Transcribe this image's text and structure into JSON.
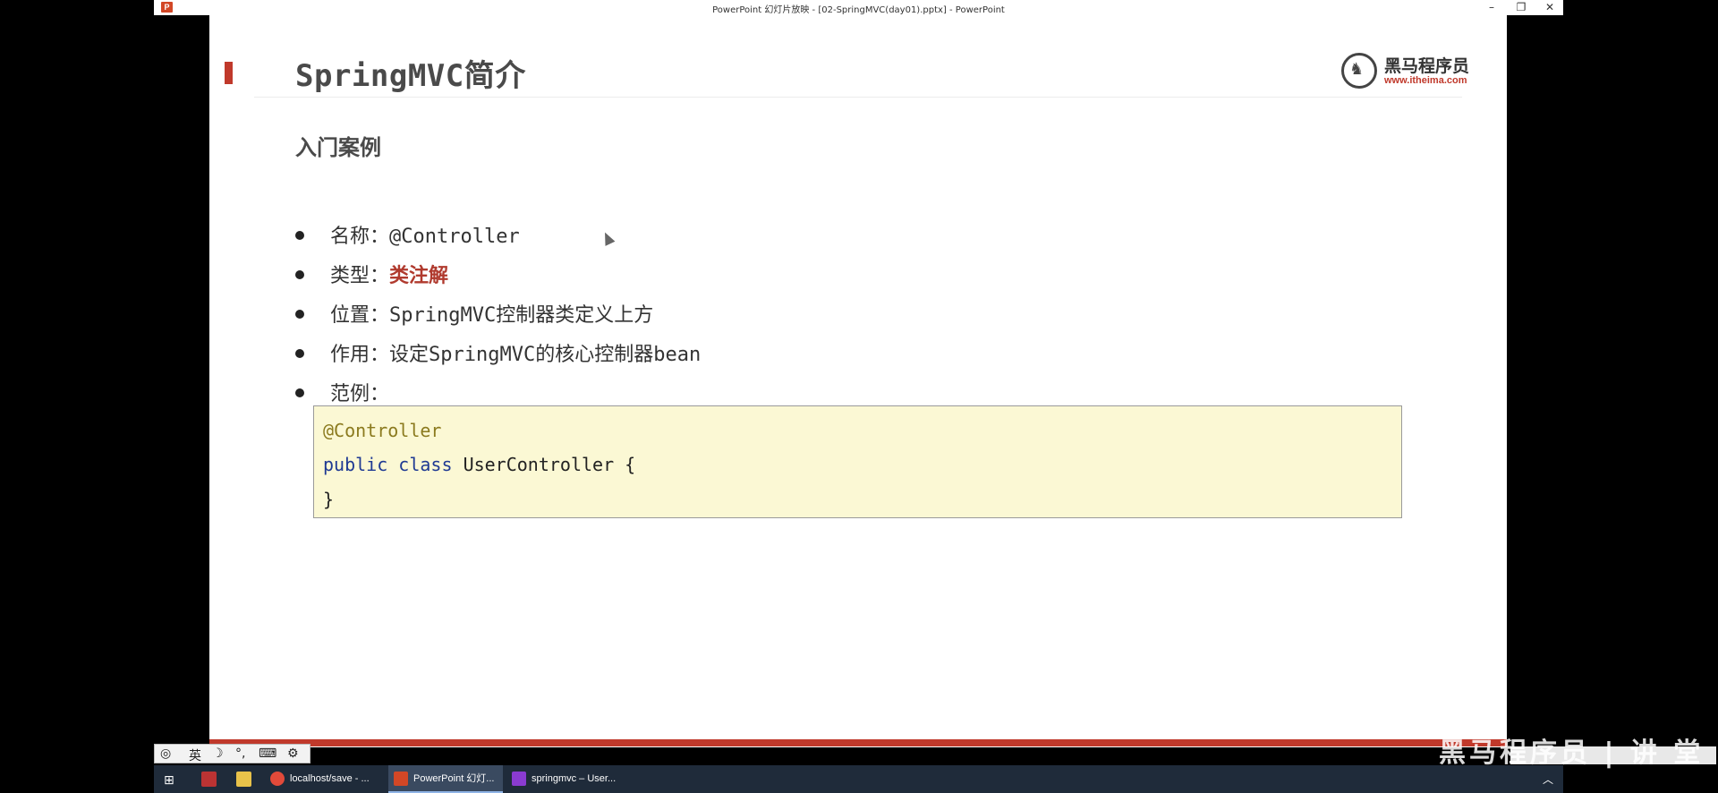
{
  "window": {
    "title": "PowerPoint 幻灯片放映 - [02-SpringMVC(day01).pptx] - PowerPoint",
    "app_icon": "P",
    "controls": {
      "minimize": "–",
      "restore": "❐",
      "close": "✕"
    }
  },
  "slide": {
    "title": "SpringMVC简介",
    "logo": {
      "name": "黑马程序员",
      "url": "www.itheima.com"
    },
    "subtitle": "入门案例",
    "bullets": [
      {
        "label": "名称：",
        "value": "@Controller"
      },
      {
        "label": "类型：",
        "value": "类注解"
      },
      {
        "label": "位置：",
        "value": "SpringMVC控制器类定义上方"
      },
      {
        "label": "作用：",
        "value": "设定SpringMVC的核心控制器bean"
      },
      {
        "label": "范例：",
        "value": ""
      }
    ],
    "code": {
      "annotation": "@Controller",
      "kw_public": "public",
      "kw_class": "class",
      "class_decl": "UserController {",
      "close": "}"
    },
    "colors": {
      "accent": "#c0392b",
      "code_bg": "#fbf8d4"
    }
  },
  "ime_bar": {
    "lang": "英",
    "items": [
      "moon-icon",
      "punct-icon",
      "keyboard-icon",
      "settings-icon"
    ]
  },
  "taskbar": {
    "items": [
      {
        "label": "localhost/save - ..."
      },
      {
        "label": "PowerPoint 幻灯..."
      },
      {
        "label": "springmvc – User..."
      }
    ]
  },
  "watermark": "黑马程序员 | 讲 堂"
}
